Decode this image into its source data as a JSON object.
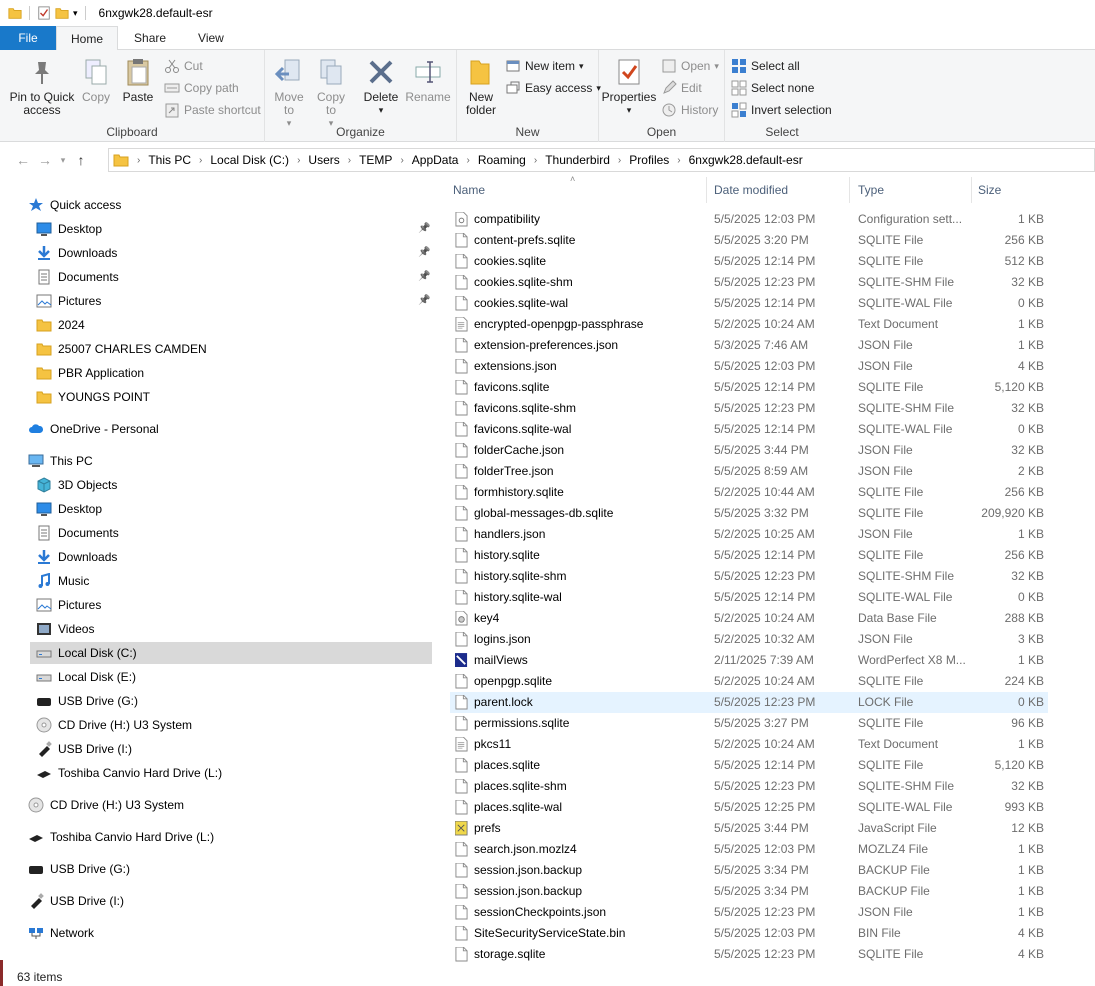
{
  "window": {
    "title": "6nxgwk28.default-esr"
  },
  "ribbon_tabs": [
    "File",
    "Home",
    "Share",
    "View"
  ],
  "ribbon": {
    "clipboard": {
      "label": "Clipboard",
      "pin_label": "Pin to Quick access",
      "copy_label": "Copy",
      "paste_label": "Paste",
      "cut_label": "Cut",
      "copy_path_label": "Copy path",
      "paste_shortcut_label": "Paste shortcut"
    },
    "organize": {
      "label": "Organize",
      "move_to_label": "Move to",
      "copy_to_label": "Copy to",
      "delete_label": "Delete",
      "rename_label": "Rename"
    },
    "new": {
      "label": "New",
      "new_folder_label": "New folder",
      "new_item_label": "New item",
      "easy_access_label": "Easy access"
    },
    "open": {
      "label": "Open",
      "properties_label": "Properties",
      "open_label": "Open",
      "edit_label": "Edit",
      "history_label": "History"
    },
    "select": {
      "label": "Select",
      "select_all_label": "Select all",
      "select_none_label": "Select none",
      "invert_label": "Invert selection"
    }
  },
  "breadcrumb": [
    "This PC",
    "Local Disk (C:)",
    "Users",
    "TEMP",
    "AppData",
    "Roaming",
    "Thunderbird",
    "Profiles",
    "6nxgwk28.default-esr"
  ],
  "nav_pane": [
    {
      "label": "Quick access",
      "icon": "star-icon"
    },
    {
      "label": "Desktop",
      "icon": "desktop-icon"
    },
    {
      "label": "Downloads",
      "icon": "download-icon"
    },
    {
      "label": "Documents",
      "icon": "documents-icon"
    },
    {
      "label": "Pictures",
      "icon": "pictures-icon"
    },
    {
      "label": "2024",
      "icon": "folder-icon"
    },
    {
      "label": "25007 CHARLES CAMDEN",
      "icon": "folder-icon"
    },
    {
      "label": "PBR Application",
      "icon": "folder-icon"
    },
    {
      "label": "YOUNGS POINT",
      "icon": "folder-icon"
    },
    {
      "label": "OneDrive - Personal",
      "icon": "cloud-icon"
    },
    {
      "label": "This PC",
      "icon": "computer-icon"
    },
    {
      "label": "3D Objects",
      "icon": "cube-icon"
    },
    {
      "label": "Desktop",
      "icon": "desktop-icon"
    },
    {
      "label": "Documents",
      "icon": "documents-icon"
    },
    {
      "label": "Downloads",
      "icon": "download-icon"
    },
    {
      "label": "Music",
      "icon": "music-icon"
    },
    {
      "label": "Pictures",
      "icon": "pictures-icon"
    },
    {
      "label": "Videos",
      "icon": "video-icon"
    },
    {
      "label": "Local Disk (C:)",
      "icon": "drive-icon"
    },
    {
      "label": "Local Disk (E:)",
      "icon": "drive-icon"
    },
    {
      "label": "USB Drive (G:)",
      "icon": "usb-drive-icon"
    },
    {
      "label": "CD Drive (H:) U3 System",
      "icon": "cd-icon"
    },
    {
      "label": "USB Drive (I:)",
      "icon": "usb-stick-icon"
    },
    {
      "label": "Toshiba Canvio Hard Drive (L:)",
      "icon": "hard-drive-icon"
    },
    {
      "label": "CD Drive (H:) U3 System",
      "icon": "cd-icon"
    },
    {
      "label": "Toshiba Canvio Hard Drive (L:)",
      "icon": "hard-drive-icon"
    },
    {
      "label": "USB Drive (G:)",
      "icon": "usb-drive-icon"
    },
    {
      "label": "USB Drive (I:)",
      "icon": "usb-stick-icon"
    },
    {
      "label": "Network",
      "icon": "network-icon"
    }
  ],
  "columns": [
    "Name",
    "Date modified",
    "Type",
    "Size"
  ],
  "files": [
    {
      "name": "compatibility",
      "date": "5/5/2025 12:03 PM",
      "type": "Configuration sett...",
      "size": "1 KB",
      "icon": "config-file-icon"
    },
    {
      "name": "content-prefs.sqlite",
      "date": "5/5/2025 3:20 PM",
      "type": "SQLITE File",
      "size": "256 KB",
      "icon": "file-icon"
    },
    {
      "name": "cookies.sqlite",
      "date": "5/5/2025 12:14 PM",
      "type": "SQLITE File",
      "size": "512 KB",
      "icon": "file-icon"
    },
    {
      "name": "cookies.sqlite-shm",
      "date": "5/5/2025 12:23 PM",
      "type": "SQLITE-SHM File",
      "size": "32 KB",
      "icon": "file-icon"
    },
    {
      "name": "cookies.sqlite-wal",
      "date": "5/5/2025 12:14 PM",
      "type": "SQLITE-WAL File",
      "size": "0 KB",
      "icon": "file-icon"
    },
    {
      "name": "encrypted-openpgp-passphrase",
      "date": "5/2/2025 10:24 AM",
      "type": "Text Document",
      "size": "1 KB",
      "icon": "text-file-icon"
    },
    {
      "name": "extension-preferences.json",
      "date": "5/3/2025 7:46 AM",
      "type": "JSON File",
      "size": "1 KB",
      "icon": "file-icon"
    },
    {
      "name": "extensions.json",
      "date": "5/5/2025 12:03 PM",
      "type": "JSON File",
      "size": "4 KB",
      "icon": "file-icon"
    },
    {
      "name": "favicons.sqlite",
      "date": "5/5/2025 12:14 PM",
      "type": "SQLITE File",
      "size": "5,120 KB",
      "icon": "file-icon"
    },
    {
      "name": "favicons.sqlite-shm",
      "date": "5/5/2025 12:23 PM",
      "type": "SQLITE-SHM File",
      "size": "32 KB",
      "icon": "file-icon"
    },
    {
      "name": "favicons.sqlite-wal",
      "date": "5/5/2025 12:14 PM",
      "type": "SQLITE-WAL File",
      "size": "0 KB",
      "icon": "file-icon"
    },
    {
      "name": "folderCache.json",
      "date": "5/5/2025 3:44 PM",
      "type": "JSON File",
      "size": "32 KB",
      "icon": "file-icon"
    },
    {
      "name": "folderTree.json",
      "date": "5/5/2025 8:59 AM",
      "type": "JSON File",
      "size": "2 KB",
      "icon": "file-icon"
    },
    {
      "name": "formhistory.sqlite",
      "date": "5/2/2025 10:44 AM",
      "type": "SQLITE File",
      "size": "256 KB",
      "icon": "file-icon"
    },
    {
      "name": "global-messages-db.sqlite",
      "date": "5/5/2025 3:32 PM",
      "type": "SQLITE File",
      "size": "209,920 KB",
      "icon": "file-icon"
    },
    {
      "name": "handlers.json",
      "date": "5/2/2025 10:25 AM",
      "type": "JSON File",
      "size": "1 KB",
      "icon": "file-icon"
    },
    {
      "name": "history.sqlite",
      "date": "5/5/2025 12:14 PM",
      "type": "SQLITE File",
      "size": "256 KB",
      "icon": "file-icon"
    },
    {
      "name": "history.sqlite-shm",
      "date": "5/5/2025 12:23 PM",
      "type": "SQLITE-SHM File",
      "size": "32 KB",
      "icon": "file-icon"
    },
    {
      "name": "history.sqlite-wal",
      "date": "5/5/2025 12:14 PM",
      "type": "SQLITE-WAL File",
      "size": "0 KB",
      "icon": "file-icon"
    },
    {
      "name": "key4",
      "date": "5/2/2025 10:24 AM",
      "type": "Data Base File",
      "size": "288 KB",
      "icon": "database-file-icon"
    },
    {
      "name": "logins.json",
      "date": "5/2/2025 10:32 AM",
      "type": "JSON File",
      "size": "3 KB",
      "icon": "file-icon"
    },
    {
      "name": "mailViews",
      "date": "2/11/2025 7:39 AM",
      "type": "WordPerfect X8 M...",
      "size": "1 KB",
      "icon": "wordperfect-file-icon"
    },
    {
      "name": "openpgp.sqlite",
      "date": "5/2/2025 10:24 AM",
      "type": "SQLITE File",
      "size": "224 KB",
      "icon": "file-icon"
    },
    {
      "name": "parent.lock",
      "date": "5/5/2025 12:23 PM",
      "type": "LOCK File",
      "size": "0 KB",
      "icon": "file-icon"
    },
    {
      "name": "permissions.sqlite",
      "date": "5/5/2025 3:27 PM",
      "type": "SQLITE File",
      "size": "96 KB",
      "icon": "file-icon"
    },
    {
      "name": "pkcs11",
      "date": "5/2/2025 10:24 AM",
      "type": "Text Document",
      "size": "1 KB",
      "icon": "text-file-icon"
    },
    {
      "name": "places.sqlite",
      "date": "5/5/2025 12:14 PM",
      "type": "SQLITE File",
      "size": "5,120 KB",
      "icon": "file-icon"
    },
    {
      "name": "places.sqlite-shm",
      "date": "5/5/2025 12:23 PM",
      "type": "SQLITE-SHM File",
      "size": "32 KB",
      "icon": "file-icon"
    },
    {
      "name": "places.sqlite-wal",
      "date": "5/5/2025 12:25 PM",
      "type": "SQLITE-WAL File",
      "size": "993 KB",
      "icon": "file-icon"
    },
    {
      "name": "prefs",
      "date": "5/5/2025 3:44 PM",
      "type": "JavaScript File",
      "size": "12 KB",
      "icon": "javascript-file-icon"
    },
    {
      "name": "search.json.mozlz4",
      "date": "5/5/2025 12:03 PM",
      "type": "MOZLZ4 File",
      "size": "1 KB",
      "icon": "file-icon"
    },
    {
      "name": "session.json.backup",
      "date": "5/5/2025 3:34 PM",
      "type": "BACKUP File",
      "size": "1 KB",
      "icon": "file-icon"
    },
    {
      "name": "session.json.backup",
      "date": "5/5/2025 3:34 PM",
      "type": "BACKUP File",
      "size": "1 KB",
      "icon": "file-icon"
    },
    {
      "name": "sessionCheckpoints.json",
      "date": "5/5/2025 12:23 PM",
      "type": "JSON File",
      "size": "1 KB",
      "icon": "file-icon"
    },
    {
      "name": "SiteSecurityServiceState.bin",
      "date": "5/5/2025 12:03 PM",
      "type": "BIN File",
      "size": "4 KB",
      "icon": "file-icon"
    },
    {
      "name": "storage.sqlite",
      "date": "5/5/2025 12:23 PM",
      "type": "SQLITE File",
      "size": "4 KB",
      "icon": "file-icon"
    }
  ],
  "status": {
    "item_count": "63 items"
  },
  "colors": {
    "accent": "#1979ca",
    "selection": "#d9d9d9",
    "hover_row": "#e5f3ff",
    "folder": "#f5c342"
  }
}
